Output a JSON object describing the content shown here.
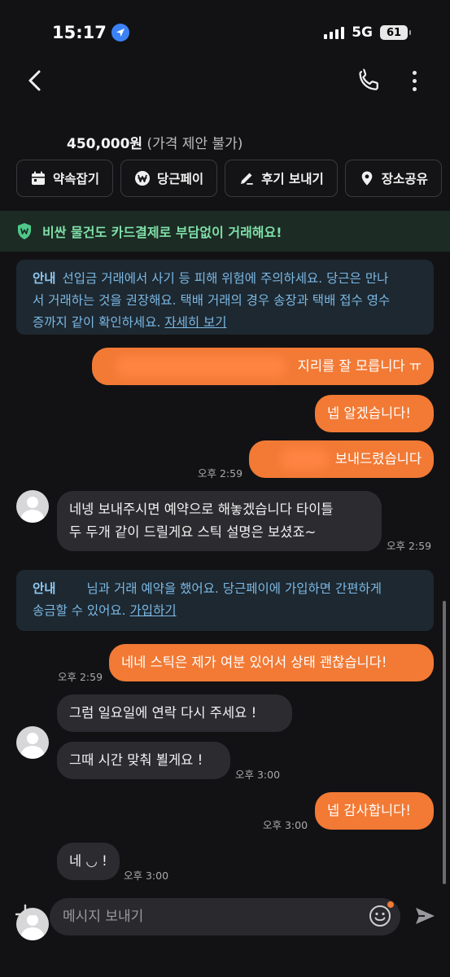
{
  "status_bar": {
    "time": "15:17",
    "network": "5G",
    "battery": "61"
  },
  "header": {
    "price": "450,000원",
    "price_note": "(가격 제안 불가)"
  },
  "actions": [
    {
      "label": "약속잡기",
      "icon": "calendar-icon"
    },
    {
      "label": "당근페이",
      "icon": "won-icon"
    },
    {
      "label": "후기 보내기",
      "icon": "pencil-icon"
    },
    {
      "label": "장소공유",
      "icon": "location-pin-icon"
    }
  ],
  "banner": {
    "text": "비싼 물건도 카드결제로 부담없이 거래해요!",
    "icon": "shield-won-icon"
  },
  "notices": [
    {
      "label": "안내",
      "lines": [
        "선입금 거래에서 사기 등 피해 위험에 주의하세요. 당근은 만나",
        "서 거래하는 것을 권장해요. 택배 거래의 경우 송장과 택배 접수 영수",
        "증까지 같이 확인하세요."
      ],
      "link": "자세히 보기"
    },
    {
      "label": "안내",
      "lines": [
        "님과 거래 예약을 했어요. 당근페이에 가입하면 간편하게",
        "송금할 수 있어요."
      ],
      "link": "가입하기"
    }
  ],
  "messages": [
    {
      "from": "me",
      "text": "지리를 잘 모릅니다 ㅠ"
    },
    {
      "from": "me",
      "text": "넵 알겠습니다!"
    },
    {
      "from": "me",
      "text": "보내드렸습니다",
      "time": "오후 2:59"
    },
    {
      "from": "them",
      "lines": [
        "네넹 보내주시면 예약으로 해놓겠습니다 타이틀",
        "두 두개 같이 드릴게요 스틱 설명은 보셨죠~"
      ],
      "time": "오후 2:59"
    },
    {
      "from": "me",
      "text": "네네 스틱은 제가 여분 있어서 상태 괜찮습니다!",
      "time": "오후 2:59"
    },
    {
      "from": "them",
      "text": "그럼 일요일에 연락 다시 주세요 !"
    },
    {
      "from": "them",
      "text": "그때 시간 맞춰 뵐게요 !",
      "time": "오후 3:00"
    },
    {
      "from": "me",
      "text": "넵 감사합니다!",
      "time": "오후 3:00"
    },
    {
      "from": "them",
      "text": "네 ◡ !",
      "time": "오후 3:00"
    }
  ],
  "composer": {
    "placeholder": "메시지 보내기"
  },
  "colors": {
    "accent": "#f27a35",
    "background": "#121214",
    "notice_text": "#7cb8e3",
    "banner_text": "#7fe0a8"
  }
}
